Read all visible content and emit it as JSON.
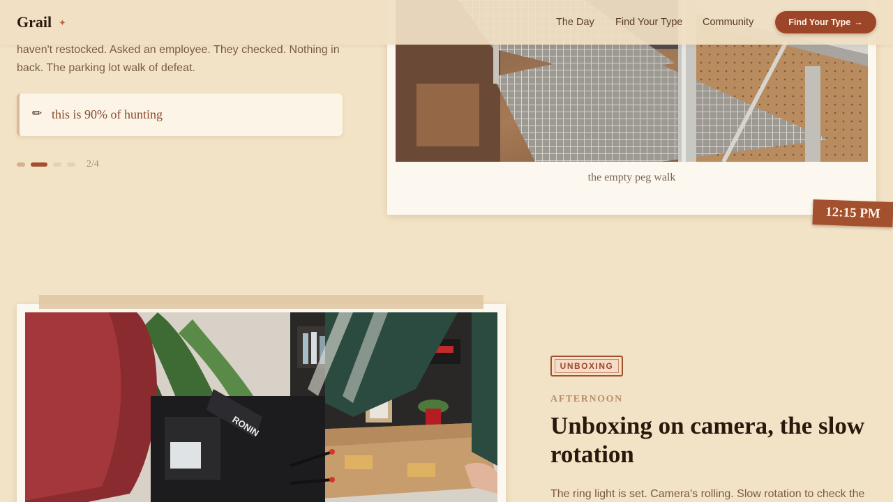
{
  "header": {
    "logo": "Grail",
    "logo_icon": "sparkle-icon",
    "nav": [
      "The Day",
      "Find Your Type",
      "Community"
    ],
    "cta_label": "Find Your Type",
    "cta_arrow": "→"
  },
  "story": {
    "body": "haven't restocked. Asked an employee. They checked. Nothing in back. The parking lot walk of defeat.",
    "note": {
      "icon": "pencil-icon",
      "text": "this is 90% of hunting"
    },
    "pager": {
      "current": 2,
      "total": 4,
      "label": "2/4"
    }
  },
  "photo_top": {
    "caption": "the empty peg walk",
    "time": "12:15 PM"
  },
  "section": {
    "tag": "UNBOXING",
    "eyebrow": "AFTERNOON",
    "headline": "Unboxing on camera, the slow rotation",
    "lede": "The ring light is set. Camera's rolling. Slow rotation to check the"
  },
  "colors": {
    "background": "#f3e3c6",
    "accent": "#a2502e",
    "heading": "#2c170c",
    "body": "#7a5a44"
  }
}
